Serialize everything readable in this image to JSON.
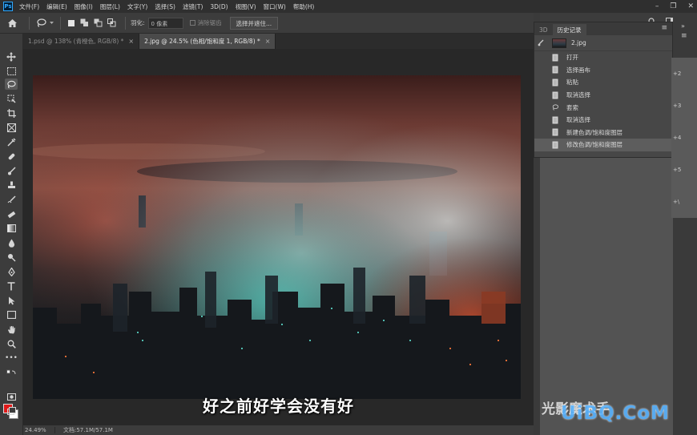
{
  "app": {
    "logo": "Ps",
    "menu": [
      "文件(F)",
      "编辑(E)",
      "图像(I)",
      "图层(L)",
      "文字(Y)",
      "选择(S)",
      "滤镜(T)",
      "3D(D)",
      "视图(V)",
      "窗口(W)",
      "帮助(H)"
    ]
  },
  "options_bar": {
    "feather_label": "羽化:",
    "feather_value": "0 像素",
    "antialias_label": "消除锯齿",
    "select_mask_label": "选择并遮住..."
  },
  "tabs": [
    {
      "label": "1.psd @ 138% (青橙色, RGB/8) *",
      "active": false
    },
    {
      "label": "2.jpg @ 24.5% (色相/饱和度 1, RGB/8) *",
      "active": true
    }
  ],
  "canvas": {
    "subtitle": "好之前好学会没有好"
  },
  "status": {
    "zoom": "24.49%",
    "doc_info": "文档:57.1M/57.1M"
  },
  "history_panel": {
    "tabs": [
      "3D",
      "历史记录"
    ],
    "snapshot_label": "2.jpg",
    "items": [
      {
        "label": "打开",
        "icon": "doc-icon",
        "current": false
      },
      {
        "label": "选择画布",
        "icon": "doc-icon",
        "current": false
      },
      {
        "label": "粘贴",
        "icon": "doc-icon",
        "current": false
      },
      {
        "label": "取消选择",
        "icon": "doc-icon",
        "current": false
      },
      {
        "label": "套索",
        "icon": "lasso-icon",
        "current": false
      },
      {
        "label": "取消选择",
        "icon": "doc-icon",
        "current": false
      },
      {
        "label": "新建色调/饱和度图层",
        "icon": "doc-icon",
        "current": false
      },
      {
        "label": "修改色调/饱和度图层",
        "icon": "doc-icon",
        "current": true
      }
    ]
  },
  "dock_strip_labels": [
    "+2",
    "+3",
    "+4",
    "+5",
    "+\\"
  ],
  "watermark": {
    "text": "光影魔术手",
    "site": "UiBQ.CoM"
  },
  "colors": {
    "foreground": "#e01a1a",
    "background": "#ffffff",
    "ui_dark": "#2f2f2f",
    "ui_panel": "#3c3c3c"
  }
}
